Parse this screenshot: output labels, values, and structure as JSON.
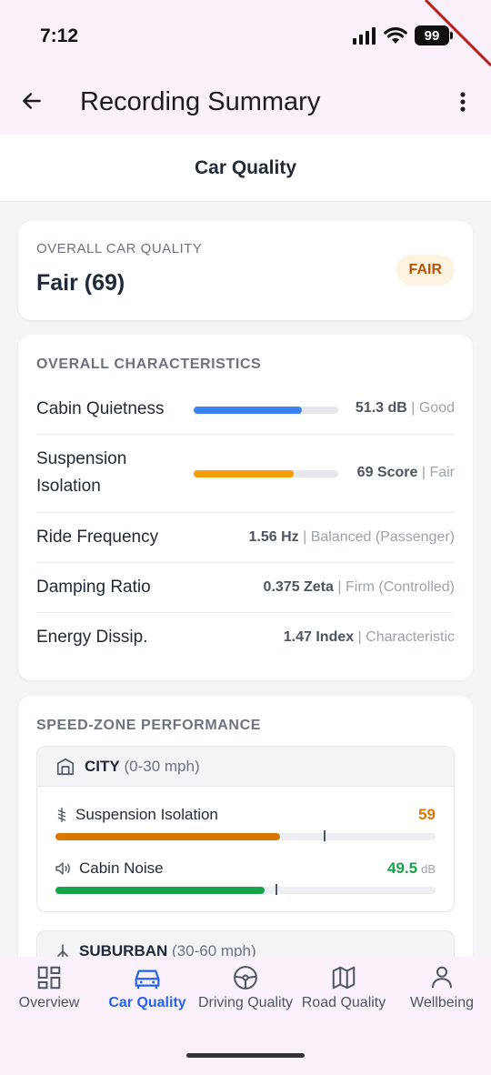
{
  "status": {
    "time": "7:12",
    "battery": "99"
  },
  "app_bar": {
    "title": "Recording Summary"
  },
  "section": {
    "title": "Car Quality"
  },
  "overall": {
    "label": "OVERALL CAR QUALITY",
    "value": "Fair (69)",
    "badge": "FAIR",
    "badge_color": "#b45309"
  },
  "characteristics": {
    "title": "OVERALL CHARACTERISTICS",
    "rows": [
      {
        "label": "Cabin Quietness",
        "value": "51.3 dB",
        "rating": "Good",
        "bar_fraction": 0.75,
        "bar_color": "#3b82f6"
      },
      {
        "label": "Suspension Isolation",
        "value": "69 Score",
        "rating": "Fair",
        "bar_fraction": 0.69,
        "bar_color": "#f59e0b"
      },
      {
        "label": "Ride Frequency",
        "value": "1.56 Hz",
        "rating": "Balanced (Passenger)"
      },
      {
        "label": "Damping Ratio",
        "value": "0.375 Zeta",
        "rating": "Firm (Controlled)"
      },
      {
        "label": "Energy Dissip.",
        "value": "1.47 Index",
        "rating": "Characteristic"
      }
    ]
  },
  "speed_zones": {
    "title": "SPEED-ZONE PERFORMANCE",
    "zones": [
      {
        "name": "CITY",
        "range": "(0-30 mph)",
        "metrics": [
          {
            "label": "Suspension Isolation",
            "value": "59",
            "unit": "",
            "color": "#d97706",
            "fraction": 0.59,
            "marker_fraction": 0.705
          },
          {
            "label": "Cabin Noise",
            "value": "49.5",
            "unit": "dB",
            "color": "#16a34a",
            "fraction": 0.55,
            "marker_fraction": 0.58
          }
        ]
      },
      {
        "name": "SUBURBAN",
        "range": "(30-60 mph)"
      }
    ]
  },
  "nav": {
    "items": [
      {
        "label": "Overview",
        "icon": "grid-icon"
      },
      {
        "label": "Car Quality",
        "icon": "car-icon",
        "active": true
      },
      {
        "label": "Driving Quality",
        "icon": "steering-wheel-icon"
      },
      {
        "label": "Road Quality",
        "icon": "map-icon"
      },
      {
        "label": "Wellbeing",
        "icon": "person-icon"
      }
    ]
  }
}
